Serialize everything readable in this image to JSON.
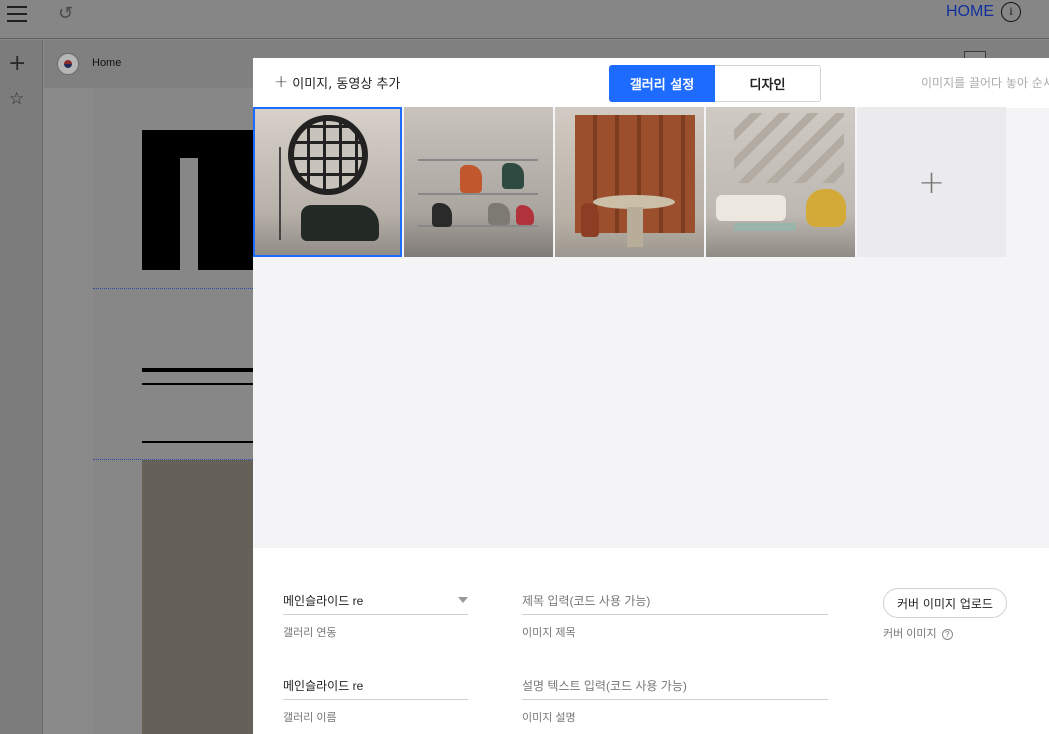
{
  "topbar": {
    "home_label": "HOME",
    "menu_icon": "hamburger-menu-icon",
    "undo_icon": "undo-icon",
    "info_icon": "info-icon"
  },
  "sidebar": {
    "add_icon": "plus-icon",
    "pin_icon": "pin-icon"
  },
  "breadcrumb": {
    "home_label": "Home"
  },
  "modal": {
    "add_media_label": "이미지, 동영상 추가",
    "tabs": [
      {
        "label": "갤러리 설정",
        "active": true
      },
      {
        "label": "디자인",
        "active": false
      }
    ],
    "hint": "이미지를 끌어다 놓아 순서",
    "accent_color": "#1d6bff",
    "thumbnails": [
      {
        "name": "gallery-image-1",
        "selected": true
      },
      {
        "name": "gallery-image-2",
        "selected": false
      },
      {
        "name": "gallery-image-3",
        "selected": false
      },
      {
        "name": "gallery-image-4",
        "selected": false
      }
    ]
  },
  "form": {
    "gallery_link_value": "메인슬라이드 re",
    "gallery_link_caption": "갤러리 연동",
    "title_placeholder": "제목 입력(코드 사용 가능)",
    "title_caption": "이미지 제목",
    "cover_button_label": "커버 이미지 업로드",
    "cover_caption": "커버 이미지",
    "gallery_name_value": "메인슬라이드 re",
    "gallery_name_caption": "갤러리 이름",
    "desc_placeholder": "설명 텍스트 입력(코드 사용 가능)",
    "desc_caption": "이미지 설명"
  }
}
